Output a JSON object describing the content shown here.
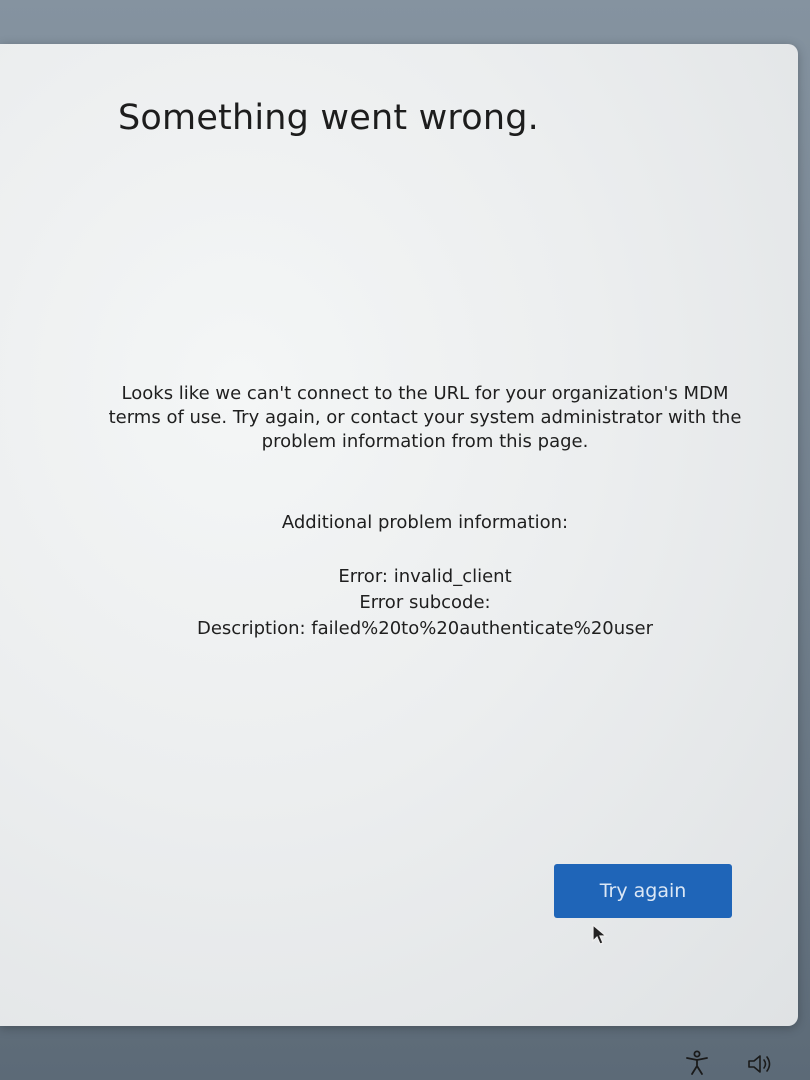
{
  "page": {
    "title": "Something went wrong.",
    "message": "Looks like we can't connect to the URL for your organization's MDM terms of use. Try again, or contact your system administrator with the problem information from this page.",
    "additional_info_heading": "Additional problem information:",
    "error_line": "Error: invalid_client",
    "subcode_line": "Error subcode:",
    "description_line": "Description: failed%20to%20authenticate%20user"
  },
  "actions": {
    "try_again_label": "Try again"
  },
  "taskbar": {
    "icons": [
      "accessibility-icon",
      "volume-icon"
    ]
  },
  "colors": {
    "button_background": "#1f65b8",
    "panel_background": "#eceeef",
    "text": "#1f1f1f"
  }
}
